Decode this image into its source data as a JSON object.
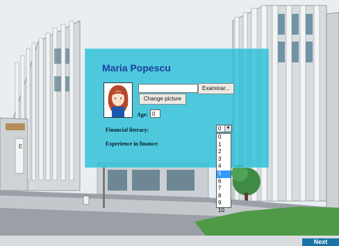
{
  "profile": {
    "name": "Maria Popescu",
    "avatar_icon": "girl-avatar-icon",
    "browse_label": "Examinar...",
    "change_picture_label": "Change picture",
    "file_value": ""
  },
  "form": {
    "age_label": "Age:",
    "age_value": "0",
    "financial_literacy_label": "Financial literacy:",
    "experience_label": "Experience in finance:",
    "financial_literacy_selected": "0",
    "financial_literacy_highlighted": "5",
    "financial_literacy_options": [
      "0",
      "1",
      "2",
      "3",
      "4",
      "5",
      "6",
      "7",
      "8",
      "9",
      "10"
    ]
  },
  "footer": {
    "next_label": "Next"
  },
  "colors": {
    "panel": "#26bed7",
    "name": "#1c3ea0",
    "next": "#1b74a6",
    "highlight": "#3399ff"
  }
}
